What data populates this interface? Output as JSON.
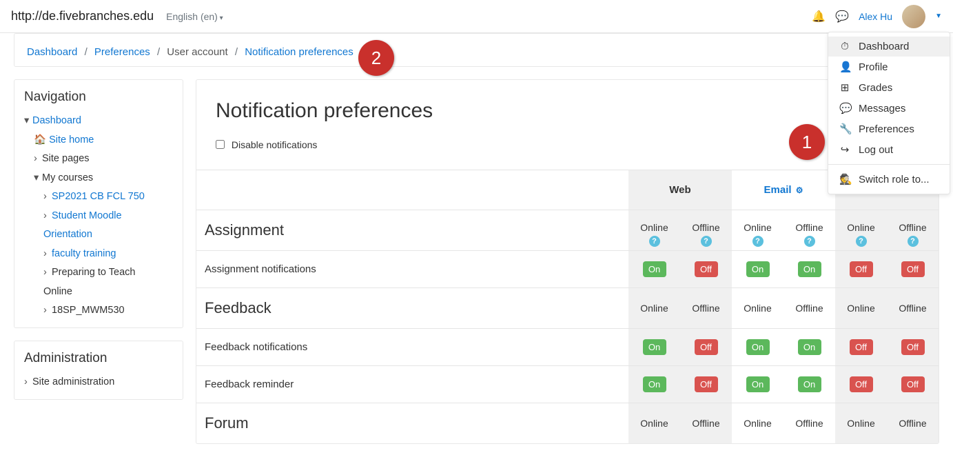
{
  "topbar": {
    "url": "http://de.fivebranches.edu",
    "language": "English (en)",
    "username": "Alex Hu"
  },
  "dropdown": {
    "items": [
      {
        "label": "Dashboard",
        "icon": "◉",
        "highlight": true
      },
      {
        "label": "Profile",
        "icon": "👤"
      },
      {
        "label": "Grades",
        "icon": "⊞"
      },
      {
        "label": "Messages",
        "icon": "💬"
      },
      {
        "label": "Preferences",
        "icon": "🔧"
      },
      {
        "label": "Log out",
        "icon": "↪"
      }
    ],
    "switch_role": "Switch role to..."
  },
  "breadcrumbs": {
    "dashboard": "Dashboard",
    "preferences": "Preferences",
    "user_account": "User account",
    "notif_pref": "Notification preferences"
  },
  "navigation": {
    "title": "Navigation",
    "dashboard": "Dashboard",
    "site_home": "Site home",
    "site_pages": "Site pages",
    "my_courses": "My courses",
    "course1": "SP2021 CB FCL 750",
    "course2a": "Student Moodle",
    "course2b": "Orientation",
    "course3": "faculty training",
    "course4a": "Preparing to Teach",
    "course4b": "Online",
    "course5": "18SP_MWM530"
  },
  "administration": {
    "title": "Administration",
    "site_admin": "Site administration"
  },
  "main": {
    "title": "Notification preferences",
    "disable_label": "Disable notifications",
    "head_web": "Web",
    "head_email": "Email",
    "online": "Online",
    "offline": "Offline",
    "on": "On",
    "off": "Off",
    "sections": {
      "assignment": "Assignment",
      "assignment_row": "Assignment notifications",
      "feedback": "Feedback",
      "feedback_row1": "Feedback notifications",
      "feedback_row2": "Feedback reminder",
      "forum": "Forum"
    }
  },
  "annotations": {
    "b1": "1",
    "b2": "2"
  }
}
